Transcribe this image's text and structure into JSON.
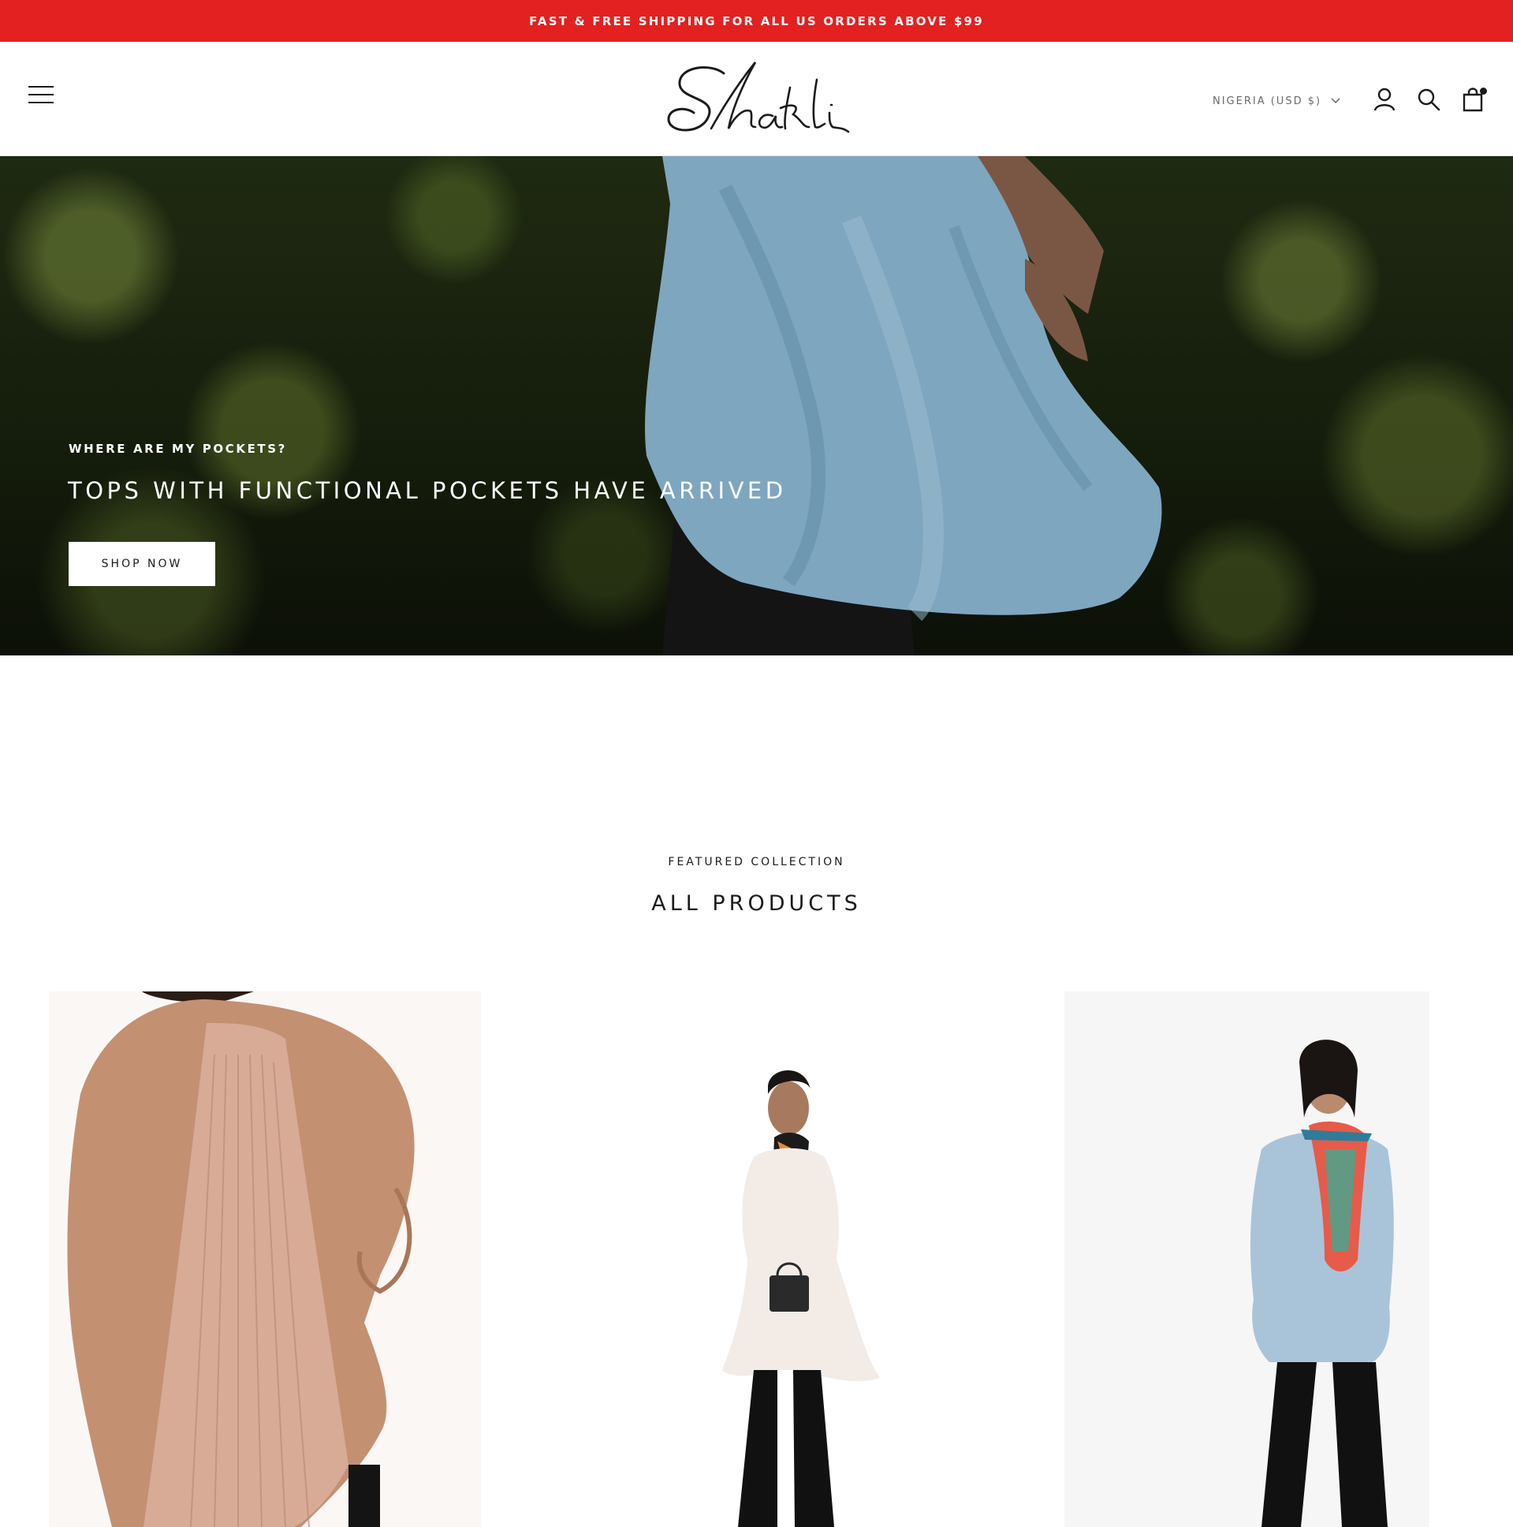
{
  "announcement": {
    "text": "FAST & FREE SHIPPING FOR ALL US ORDERS ABOVE $99",
    "background": "#e22120"
  },
  "header": {
    "logo_text": "Shakli",
    "country_selector": "NIGERIA (USD $)",
    "icons": [
      "menu-icon",
      "user-icon",
      "search-icon",
      "cart-icon"
    ]
  },
  "hero": {
    "kicker": "WHERE ARE MY POCKETS?",
    "title": "TOPS WITH FUNCTIONAL POCKETS HAVE ARRIVED",
    "button_label": "SHOP NOW"
  },
  "featured": {
    "kicker": "FEATURED COLLECTION",
    "title": "ALL PRODUCTS"
  },
  "products": [
    {
      "image": "tan-pleated-back-top"
    },
    {
      "image": "white-eyelet-tunic-with-scarf"
    },
    {
      "image": "light-blue-top-with-printed-scarf"
    }
  ]
}
